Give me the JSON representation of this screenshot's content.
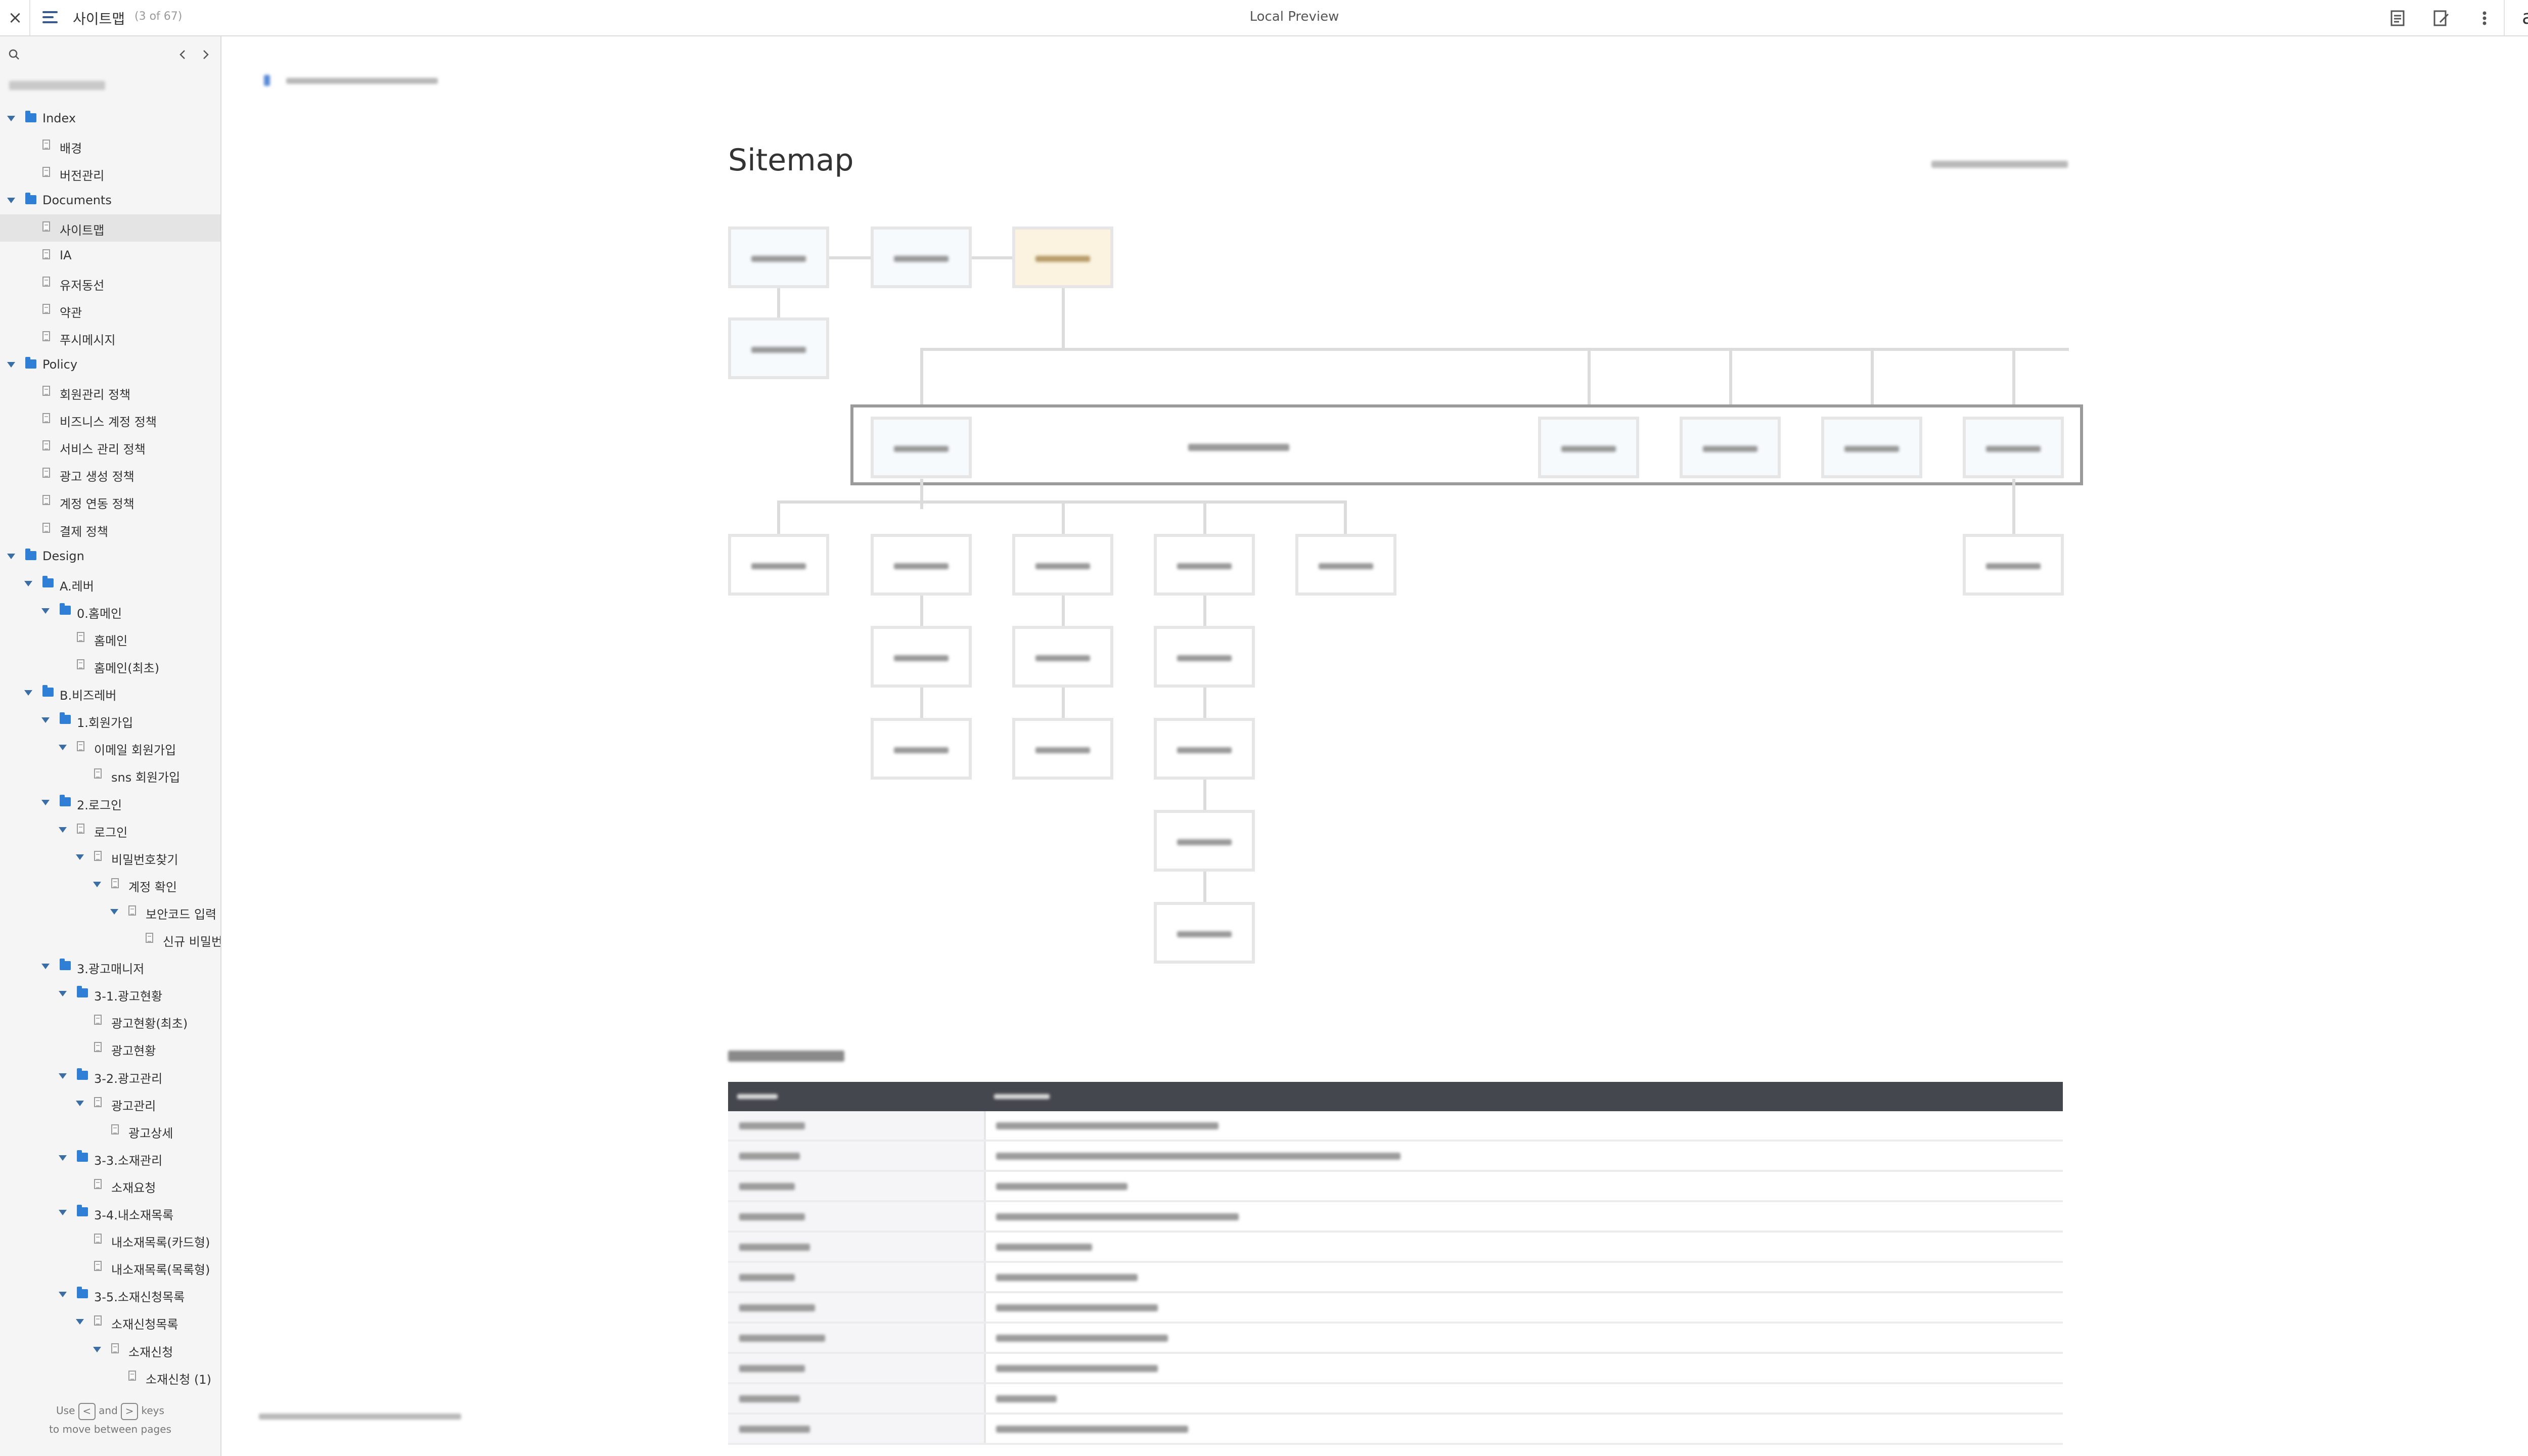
{
  "topbar": {
    "page_title": "사이트맵",
    "page_count": "(3 of 67)",
    "center_title": "Local Preview",
    "logo": "axure"
  },
  "sidebar": {
    "items": [
      {
        "label": "Index",
        "type": "folder",
        "depth": 0,
        "expanded": true
      },
      {
        "label": "배경",
        "type": "page",
        "depth": 1
      },
      {
        "label": "버전관리",
        "type": "page",
        "depth": 1
      },
      {
        "label": "Documents",
        "type": "folder",
        "depth": 0,
        "expanded": true
      },
      {
        "label": "사이트맵",
        "type": "page",
        "depth": 1,
        "selected": true
      },
      {
        "label": "IA",
        "type": "page",
        "depth": 1
      },
      {
        "label": "유저동선",
        "type": "page",
        "depth": 1
      },
      {
        "label": "약관",
        "type": "page",
        "depth": 1
      },
      {
        "label": "푸시메시지",
        "type": "page",
        "depth": 1
      },
      {
        "label": "Policy",
        "type": "folder",
        "depth": 0,
        "expanded": true
      },
      {
        "label": "회원관리 정책",
        "type": "page",
        "depth": 1
      },
      {
        "label": "비즈니스 계정 정책",
        "type": "page",
        "depth": 1
      },
      {
        "label": "서비스 관리 정책",
        "type": "page",
        "depth": 1
      },
      {
        "label": "광고 생성 정책",
        "type": "page",
        "depth": 1
      },
      {
        "label": "계정 연동 정책",
        "type": "page",
        "depth": 1
      },
      {
        "label": "결제 정책",
        "type": "page",
        "depth": 1
      },
      {
        "label": "Design",
        "type": "folder",
        "depth": 0,
        "expanded": true
      },
      {
        "label": "A.레버",
        "type": "folder",
        "depth": 1,
        "expanded": true
      },
      {
        "label": "0.홈메인",
        "type": "folder",
        "depth": 2,
        "expanded": true
      },
      {
        "label": "홈메인",
        "type": "page",
        "depth": 3
      },
      {
        "label": "홈메인(최초)",
        "type": "page",
        "depth": 3
      },
      {
        "label": "B.비즈레버",
        "type": "folder",
        "depth": 1,
        "expanded": true
      },
      {
        "label": "1.회원가입",
        "type": "folder",
        "depth": 2,
        "expanded": true
      },
      {
        "label": "이메일 회원가입",
        "type": "page",
        "depth": 3,
        "expanded": true
      },
      {
        "label": "sns 회원가입",
        "type": "page",
        "depth": 4
      },
      {
        "label": "2.로그인",
        "type": "folder",
        "depth": 2,
        "expanded": true
      },
      {
        "label": "로그인",
        "type": "page",
        "depth": 3,
        "expanded": true
      },
      {
        "label": "비밀번호찾기",
        "type": "page",
        "depth": 4,
        "expanded": true
      },
      {
        "label": "계정 확인",
        "type": "page",
        "depth": 5,
        "expanded": true
      },
      {
        "label": "보안코드 입력",
        "type": "page",
        "depth": 6,
        "expanded": true
      },
      {
        "label": "신규 비밀번",
        "type": "page",
        "depth": 7
      },
      {
        "label": "3.광고매니저",
        "type": "folder",
        "depth": 2,
        "expanded": true
      },
      {
        "label": "3-1.광고현황",
        "type": "folder",
        "depth": 3,
        "expanded": true
      },
      {
        "label": "광고현황(최초)",
        "type": "page",
        "depth": 4
      },
      {
        "label": "광고현황",
        "type": "page",
        "depth": 4
      },
      {
        "label": "3-2.광고관리",
        "type": "folder",
        "depth": 3,
        "expanded": true
      },
      {
        "label": "광고관리",
        "type": "page",
        "depth": 4,
        "expanded": true
      },
      {
        "label": "광고상세",
        "type": "page",
        "depth": 5
      },
      {
        "label": "3-3.소재관리",
        "type": "folder",
        "depth": 3,
        "expanded": true
      },
      {
        "label": "소재요청",
        "type": "page",
        "depth": 4
      },
      {
        "label": "3-4.내소재목록",
        "type": "folder",
        "depth": 3,
        "expanded": true
      },
      {
        "label": "내소재목록(카드형)",
        "type": "page",
        "depth": 4
      },
      {
        "label": "내소재목록(목록형)",
        "type": "page",
        "depth": 4
      },
      {
        "label": "3-5.소재신청목록",
        "type": "folder",
        "depth": 3,
        "expanded": true
      },
      {
        "label": "소재신청목록",
        "type": "page",
        "depth": 4,
        "expanded": true
      },
      {
        "label": "소재신청",
        "type": "page",
        "depth": 5,
        "expanded": true
      },
      {
        "label": "소재신청 (1)",
        "type": "page",
        "depth": 6
      }
    ],
    "footer_use": "Use",
    "footer_and": "and",
    "footer_keys": "keys",
    "footer_move": "to move between pages",
    "key_prev": "<",
    "key_next": ">"
  },
  "main": {
    "title": "Sitemap"
  },
  "colors": {
    "accent": "#2f7fd6",
    "selected_row": "#e4e4e4",
    "table_header": "#45474e",
    "highlight_box": "#fbf3df"
  },
  "icons": [
    "close-icon",
    "hamburger-menu-icon",
    "search-icon",
    "chevron-left-icon",
    "chevron-right-icon",
    "notes-icon",
    "edit-icon",
    "more-vertical-icon",
    "folder-icon",
    "page-icon"
  ]
}
